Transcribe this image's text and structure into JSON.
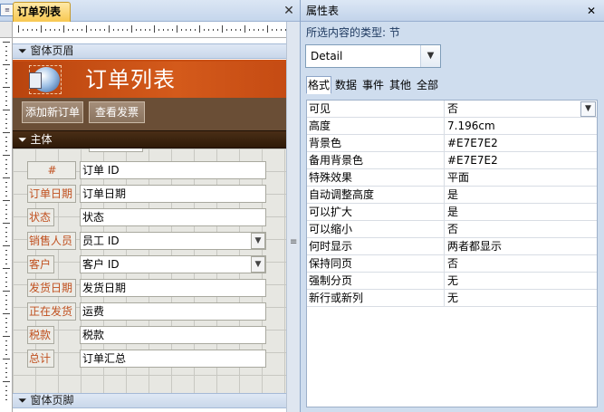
{
  "document_tab": {
    "label": "订单列表",
    "icon": "form-icon",
    "close_label": "✕"
  },
  "sections": {
    "header": "窗体页眉",
    "detail": "主体",
    "footer": "窗体页脚"
  },
  "form_header": {
    "title": "订单列表",
    "logo": "form-logo-icon",
    "buttons": [
      "添加新订单",
      "查看发票"
    ]
  },
  "detail_controls": [
    {
      "label": "#",
      "field": "订单 ID",
      "combo": false
    },
    {
      "label": "订单日期",
      "field": "订单日期",
      "combo": false
    },
    {
      "label": "状态",
      "field": "状态",
      "combo": false
    },
    {
      "label": "销售人员",
      "field": "员工 ID",
      "combo": true
    },
    {
      "label": "客户",
      "field": "客户 ID",
      "combo": true
    },
    {
      "label": "发货日期",
      "field": "发货日期",
      "combo": false
    },
    {
      "label": "正在发货",
      "field": "运费",
      "combo": false
    },
    {
      "label": "税款",
      "field": "税款",
      "combo": false
    },
    {
      "label": "总计",
      "field": "订单汇总",
      "combo": false
    }
  ],
  "property_sheet": {
    "title": "属性表",
    "close_label": "✕",
    "selection_type_label": "所选内容的类型: 节",
    "selected_object": "Detail",
    "tabs": [
      "格式",
      "数据",
      "事件",
      "其他",
      "全部"
    ],
    "active_tab": "格式",
    "properties": [
      {
        "name": "可见",
        "value": "否"
      },
      {
        "name": "高度",
        "value": "7.196cm"
      },
      {
        "name": "背景色",
        "value": "#E7E7E2"
      },
      {
        "name": "备用背景色",
        "value": "#E7E7E2"
      },
      {
        "name": "特殊效果",
        "value": "平面"
      },
      {
        "name": "自动调整高度",
        "value": "是"
      },
      {
        "name": "可以扩大",
        "value": "是"
      },
      {
        "name": "可以缩小",
        "value": "否"
      },
      {
        "name": "何时显示",
        "value": "两者都显示"
      },
      {
        "name": "保持同页",
        "value": "否"
      },
      {
        "name": "强制分页",
        "value": "无"
      },
      {
        "name": "新行或新列",
        "value": "无"
      }
    ]
  },
  "colors": {
    "header_orange": "#C94F14",
    "detail_back": "#E7E7E2",
    "label_text": "#C0501F",
    "section_dark": "#3B2410"
  }
}
